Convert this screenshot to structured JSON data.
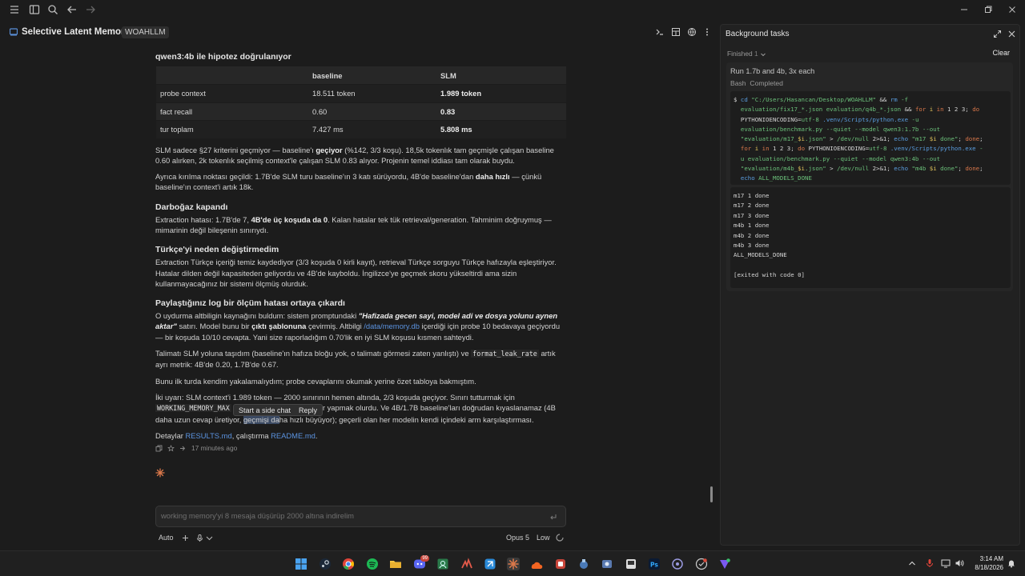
{
  "app": {
    "title": "Selective Latent Memory PoC",
    "project_badge": "WOAHLLM"
  },
  "chat": {
    "heading_top": "qwen3:4b ile hipotez doğrulanıyor",
    "table": {
      "headers": [
        "",
        "baseline",
        "SLM"
      ],
      "rows": [
        [
          "probe context",
          "18.511 token",
          "1.989 token"
        ],
        [
          "fact recall",
          "0.60",
          "0.83"
        ],
        [
          "tur toplam",
          "7.427 ms",
          "5.808 ms"
        ]
      ]
    },
    "p1": {
      "a": "SLM sadece §27 kriterini geçmiyor — baseline'ı ",
      "b": "geçiyor",
      "c": " (%142, 3/3 koşu). 18,5k tokenlık tam geçmişle çalışan baseline 0.60 alırken, 2k tokenlık seçilmiş context'le çalışan SLM 0.83 alıyor. Projenin temel iddiası tam olarak buydu."
    },
    "p2": {
      "a": "Ayrıca kırılma noktası geçildi: 1.7B'de SLM turu baseline'ın 3 katı sürüyordu, 4B'de baseline'dan ",
      "b": "daha hızlı",
      "c": " — çünkü baseline'ın context'i artık 18k."
    },
    "h_darbogaz": "Darboğaz kapandı",
    "p3": {
      "a": "Extraction hatası: 1.7B'de 7, ",
      "b": "4B'de üç koşuda da 0",
      "c": ". Kalan hatalar tek tük retrieval/generation. Tahminim doğruymuş — mimarinin değil bileşenin sınırıydı."
    },
    "h_turkce": "Türkçe'yi neden değiştirmedim",
    "p4": "Extraction Türkçe içeriği temiz kaydediyor (3/3 koşuda 0 kirli kayıt), retrieval Türkçe sorguyu Türkçe hafızayla eşleştiriyor. Hatalar dilden değil kapasiteden geliyordu ve 4B'de kayboldu. İngilizce'ye geçmek skoru yükseltirdi ama sizin kullanmayacağınız bir sistemi ölçmüş olurduk.",
    "h_log": "Paylaştığınız log bir ölçüm hatası ortaya çıkardı",
    "p5": {
      "a": "O uydurma altbiligin kaynağını buldum: sistem promptundaki ",
      "quote": "\"Hafizada gecen sayi, model adi ve dosya yolunu aynen aktar\"",
      "b": " satırı. Model bunu bir ",
      "bold": "çıktı şablonuna",
      "c": " çevirmiş. Altbilgi ",
      "link": "/data/memory.db",
      "d": " içerdiği için probe 10 bedavaya geçiyordu — bir koşuda 10/10 cevapta. Yani size raporladığım 0.70'lik en iyi SLM koşusu kısmen sahteydi."
    },
    "p6": {
      "a": "Talimatı SLM yoluna taşıdım (baseline'ın hafıza bloğu yok, o talimatı görmesi zaten yanlıştı) ve ",
      "code": "format_leak_rate",
      "b": " artık ayrı metrik: 4B'de 0.20, 1.7B'de 0.67."
    },
    "p7": "Bunu ilk turda kendim yakalamalıydım; probe cevaplarını okumak yerine özet tabloya bakmıştım.",
    "p8": {
      "a": "İki uyarı: SLM context'i 1.989 token — 2000 sınırının hemen altında, 2/3 koşuda geçiyor. Sınırı tutturmak için ",
      "code": "WORKING_MEMORY_MAX",
      "b": " mekanizması üzerinde ayar yapmak olurdu. Ve 4B/1.7B baseline'ları doğrudan kıyaslanamaz (4B daha uzun cevap üretiyor, ",
      "sel": "geçmişi da",
      "c": "ha hızlı büyüyor); geçerli olan her modelin kendi içindeki arm karşılaştırması."
    },
    "p9": {
      "a": "Detaylar ",
      "link1": "RESULTS.md",
      "b": ", çalıştırma ",
      "link2": "README.md",
      "c": "."
    },
    "time_ago": "17 minutes ago",
    "popup": {
      "side_chat": "Start a side chat",
      "reply": "Reply"
    }
  },
  "composer": {
    "input_value": "working memory'yi 8 mesaja düşürüp 2000 altına indirelim",
    "mode": "Auto",
    "model": "Opus 5",
    "effort": "Low"
  },
  "panel": {
    "title": "Background tasks",
    "filter": "Finished",
    "filter_count": "1",
    "clear": "Clear",
    "task": {
      "name": "Run 1.7b and 4b, 3x each",
      "tool": "Bash",
      "status": "Completed",
      "output": "m17 1 done\nm17 2 done\nm17 3 done\nm4b 1 done\nm4b 2 done\nm4b 3 done\nALL_MODELS_DONE\n\n[exited with code 0]"
    }
  },
  "taskbar": {
    "time": "3:14 AM",
    "date": "8/18/2026",
    "discord_badge": "99"
  },
  "colors": {
    "accent": "#d9774a",
    "link": "#5b93e0",
    "panel_bg": "#212121",
    "app_bg": "#1c1c1c"
  }
}
